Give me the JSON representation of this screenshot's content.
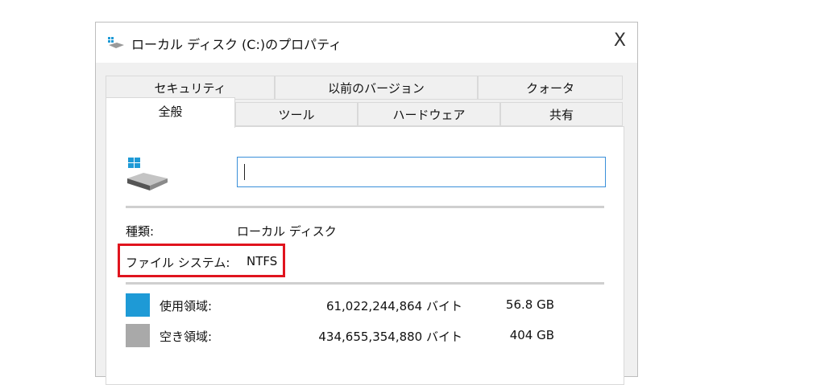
{
  "window": {
    "title": "ローカル ディスク (C:)のプロパティ",
    "close_label": "X"
  },
  "tabs_row1": [
    {
      "label": "セキュリティ"
    },
    {
      "label": "以前のバージョン"
    },
    {
      "label": "クォータ"
    }
  ],
  "tabs_row2": [
    {
      "label": "全般"
    },
    {
      "label": "ツール"
    },
    {
      "label": "ハードウェア"
    },
    {
      "label": "共有"
    }
  ],
  "general": {
    "drive_name_value": "",
    "type_label": "種類:",
    "type_value": "ローカル ディスク",
    "fs_label": "ファイル システム:",
    "fs_value": "NTFS",
    "used": {
      "label": "使用領域:",
      "bytes": "61,022,244,864 バイト",
      "size": "56.8 GB",
      "color": "#1e9ad6"
    },
    "free": {
      "label": "空き領域:",
      "bytes": "434,655,354,880 バイト",
      "size": "404 GB",
      "color": "#a9a9a9"
    }
  },
  "highlight_color": "#e0141e"
}
